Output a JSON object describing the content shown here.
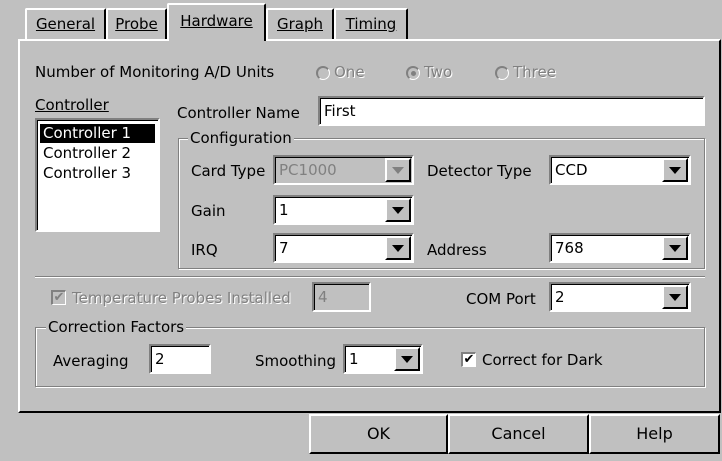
{
  "tabs": [
    {
      "label": "General"
    },
    {
      "label": "Probe"
    },
    {
      "label": "Hardware"
    },
    {
      "label": "Graph"
    },
    {
      "label": "Timing"
    }
  ],
  "monitoring": {
    "label": "Number of Monitoring A/D Units",
    "options": [
      "One",
      "Two",
      "Three"
    ],
    "selected": "Two"
  },
  "controller": {
    "label": "Controller",
    "items": [
      "Controller 1",
      "Controller 2",
      "Controller 3"
    ],
    "selected": "Controller 1"
  },
  "controller_name": {
    "label": "Controller Name",
    "value": "First"
  },
  "configuration": {
    "title": "Configuration",
    "card_type": {
      "label": "Card Type",
      "value": "PC1000"
    },
    "detector_type": {
      "label": "Detector Type",
      "value": "CCD"
    },
    "gain": {
      "label": "Gain",
      "value": "1"
    },
    "irq": {
      "label": "IRQ",
      "value": "7"
    },
    "address": {
      "label": "Address",
      "value": "768"
    }
  },
  "temperature": {
    "label": "Temperature Probes Installed",
    "value": "4",
    "checked": true
  },
  "com_port": {
    "label": "COM Port",
    "value": "2"
  },
  "correction": {
    "title": "Correction Factors",
    "averaging": {
      "label": "Averaging",
      "value": "2"
    },
    "smoothing": {
      "label": "Smoothing",
      "value": "1"
    },
    "dark": {
      "label": "Correct for Dark",
      "checked": true
    }
  },
  "buttons": {
    "ok": "OK",
    "cancel": "Cancel",
    "help": "Help"
  },
  "icons": {
    "checkmark": "✔"
  },
  "colors": {
    "face": "#c0c0c0",
    "shadow": "#808080",
    "highlight": "#ffffff",
    "selection": "#000000"
  }
}
